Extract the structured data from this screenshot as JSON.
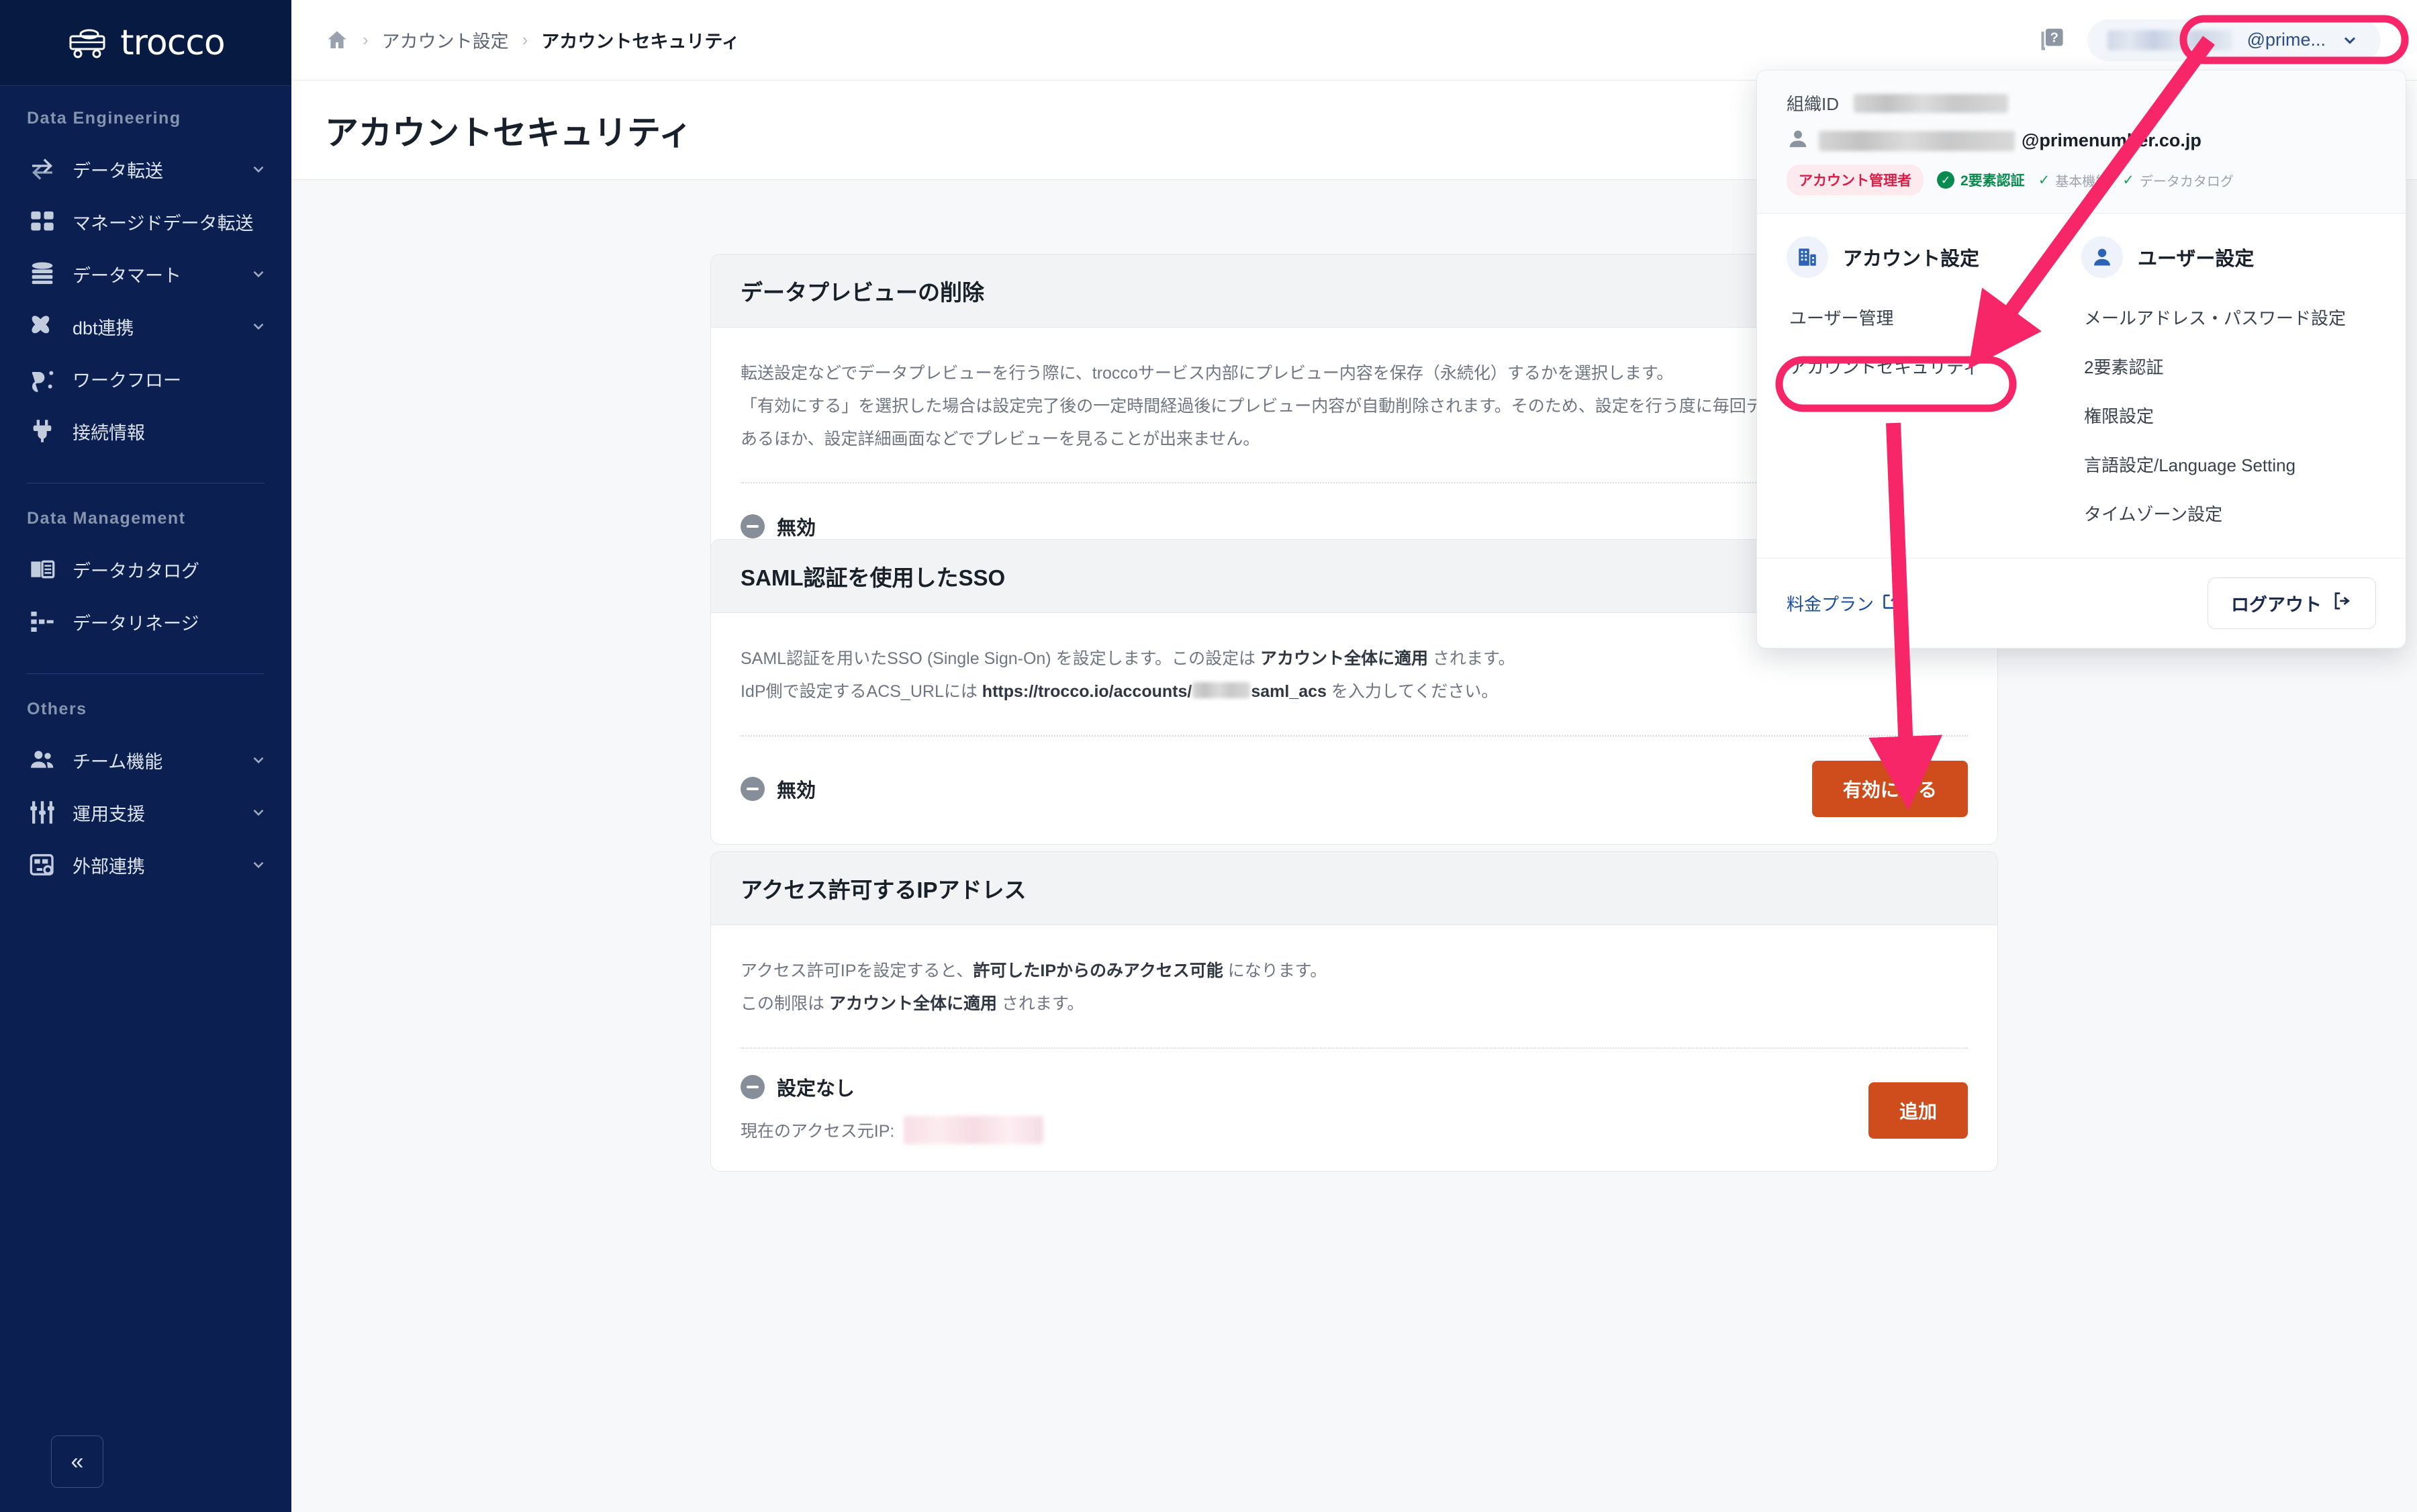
{
  "app": {
    "brand": "trocco"
  },
  "sidebar": {
    "sections": [
      {
        "title": "Data Engineering",
        "items": [
          {
            "label": "データ転送",
            "icon": "transfer-icon",
            "chevron": true
          },
          {
            "label": "マネージドデータ転送",
            "icon": "grid-icon",
            "chevron": false
          },
          {
            "label": "データマート",
            "icon": "database-icon",
            "chevron": true
          },
          {
            "label": "dbt連携",
            "icon": "dbt-icon",
            "chevron": true
          },
          {
            "label": "ワークフロー",
            "icon": "workflow-icon",
            "chevron": false
          },
          {
            "label": "接続情報",
            "icon": "plug-icon",
            "chevron": false
          }
        ]
      },
      {
        "title": "Data Management",
        "items": [
          {
            "label": "データカタログ",
            "icon": "book-icon",
            "chevron": false
          },
          {
            "label": "データリネージ",
            "icon": "lineage-icon",
            "chevron": false
          }
        ]
      },
      {
        "title": "Others",
        "items": [
          {
            "label": "チーム機能",
            "icon": "people-icon",
            "chevron": true
          },
          {
            "label": "運用支援",
            "icon": "sliders-icon",
            "chevron": true
          },
          {
            "label": "外部連携",
            "icon": "external-link-box-icon",
            "chevron": true
          }
        ]
      }
    ],
    "collapse_label": "«"
  },
  "topbar": {
    "breadcrumb": {
      "home_icon": "home-icon",
      "separator": "›",
      "parent": "アカウント設定",
      "current": "アカウントセキュリティ"
    },
    "help_icon": "help-icon",
    "user_chip": {
      "email_tail": "@prime...",
      "chevron_icon": "chevron-down-icon"
    }
  },
  "page": {
    "title": "アカウントセキュリティ"
  },
  "cards": [
    {
      "title": "データプレビューの削除",
      "lines": [
        "転送設定などでデータプレビューを行う際に、troccoサービス内部にプレビュー内容を保存（永続化）するかを選択します。",
        "「有効にする」を選択した場合は設定完了後の一定時間経過後にプレビュー内容が自動削除されます。そのため、設定を行う度に毎回データプレビューを行う必要が",
        "あるほか、設定詳細画面などでプレビューを見ることが出来ません。"
      ],
      "status": "無効",
      "button": null
    },
    {
      "title": "SAML認証を使用したSSO",
      "lines": [
        "SAML認証を用いたSSO (Single Sign-On) を設定します。この設定は アカウント全体に適用 されます。",
        "IdP側で設定するACS_URLには https://trocco.io/accounts/■■■/saml_acs を入力してください。"
      ],
      "line1_plain_a": "SAML認証を用いたSSO (Single Sign-On) を設定します。この設定は ",
      "line1_bold": "アカウント全体に適用",
      "line1_plain_b": " されます。",
      "line2_plain_a": "IdP側で設定するACS_URLには ",
      "line2_bold_a": "https://trocco.io/accounts/",
      "line2_bold_b": "saml_acs",
      "line2_plain_b": " を入力してください。",
      "status": "無効",
      "button": "有効にする"
    },
    {
      "title": "アクセス許可するIPアドレス",
      "line1_plain_a": "アクセス許可IPを設定すると、",
      "line1_bold": "許可したIPからのみアクセス可能",
      "line1_plain_b": " になります。",
      "line2_plain_a": "この制限は ",
      "line2_bold": "アカウント全体に適用",
      "line2_plain_b": " されます。",
      "status": "設定なし",
      "current_ip_label": "現在のアクセス元IP:",
      "button": "追加"
    }
  ],
  "dropdown": {
    "org_label": "組織ID",
    "user_email_tail": "@primenumber.co.jp",
    "tags": {
      "admin": "アカウント管理者",
      "two_factor": "2要素認証",
      "basic": "基本機能",
      "catalog": "データカタログ"
    },
    "columns": [
      {
        "title": "アカウント設定",
        "icon": "building-icon",
        "links": [
          "ユーザー管理",
          "アカウントセキュリティ"
        ]
      },
      {
        "title": "ユーザー設定",
        "icon": "person-icon",
        "links": [
          "メールアドレス・パスワード設定",
          "2要素認証",
          "権限設定",
          "言語設定/Language Setting",
          "タイムゾーン設定"
        ]
      }
    ],
    "pricing_link": "料金プラン",
    "logout": "ログアウト"
  },
  "colors": {
    "sidebar_bg": "#0b2050",
    "accent_orange": "#cf4c1c",
    "annotation_pink": "#f72668",
    "link_blue": "#1a4d9b",
    "green": "#0a8b4e"
  }
}
